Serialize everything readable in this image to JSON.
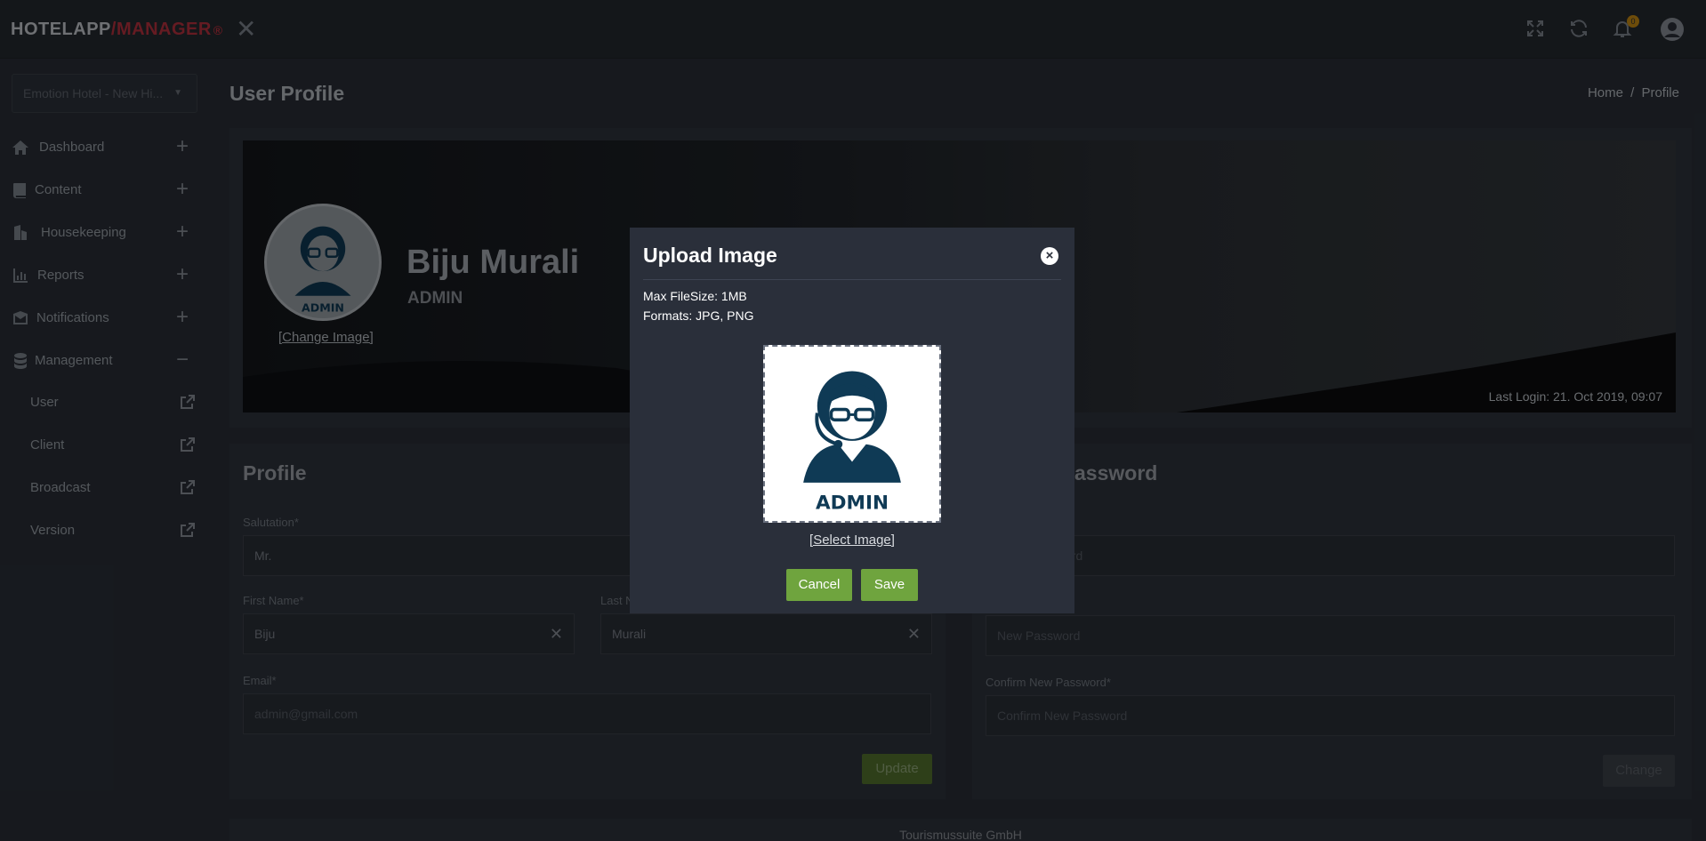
{
  "header": {
    "logo_part1": "HOTELAPP",
    "logo_part2": "/MANAGER",
    "logo_mark": "®",
    "close_label": "✕",
    "notification_count": "0",
    "icons": [
      "fullscreen-icon",
      "refresh-icon",
      "bell-icon",
      "user-avatar-icon"
    ],
    "colors": {
      "brand_red": "#b8323f",
      "accent_green": "#6fa43e",
      "badge_orange": "#c78a13"
    }
  },
  "sidebar": {
    "hotel_select": "Emotion Hotel - New Hi...",
    "items": [
      {
        "label": "Dashboard",
        "icon": "home-icon",
        "toggle": "+"
      },
      {
        "label": "Content",
        "icon": "book-icon",
        "toggle": "+"
      },
      {
        "label": "Housekeeping",
        "icon": "building-icon",
        "toggle": "+"
      },
      {
        "label": "Reports",
        "icon": "bar-chart-icon",
        "toggle": "+"
      },
      {
        "label": "Notifications",
        "icon": "envelope-icon",
        "toggle": "+"
      },
      {
        "label": "Management",
        "icon": "database-icon",
        "toggle": "−"
      }
    ],
    "sub_items": [
      {
        "label": "User",
        "icon": "external-link-icon"
      },
      {
        "label": "Client",
        "icon": "external-link-icon"
      },
      {
        "label": "Broadcast",
        "icon": "external-link-icon"
      },
      {
        "label": "Version",
        "icon": "external-link-icon"
      }
    ]
  },
  "main": {
    "page_title": "User Profile",
    "breadcrumb": {
      "home": "Home",
      "separator": "/",
      "current": "Profile"
    },
    "hero": {
      "change_image": "[Change Image]",
      "name": "Biju Murali",
      "role": "ADMIN",
      "last_login": "Last Login: 21. Oct 2019, 09:07",
      "avatar_text": "ADMIN"
    },
    "profile": {
      "title": "Profile",
      "salutation_label": "Salutation*",
      "salutation_value": "Mr.",
      "first_name_label": "First Name*",
      "first_name_value": "Biju",
      "last_name_label": "Last N",
      "last_name_value": "Murali",
      "email_label": "Email*",
      "email_placeholder": "admin@gmail.com",
      "update_button": "Update"
    },
    "password": {
      "title_visible": "assword",
      "old_placeholder_visible": "ord",
      "new_placeholder": "New Password",
      "confirm_label": "Confirm New Password*",
      "confirm_placeholder": "Confirm New Password",
      "change_button": "Change"
    },
    "footer": "Tourismussuite GmbH"
  },
  "modal": {
    "title": "Upload Image",
    "close_icon": "×",
    "max_filesize": "Max FileSize: 1MB",
    "formats": "Formats: JPG, PNG",
    "preview_text": "ADMIN",
    "select_image": "[Select Image]",
    "cancel_button": "Cancel",
    "save_button": "Save"
  }
}
